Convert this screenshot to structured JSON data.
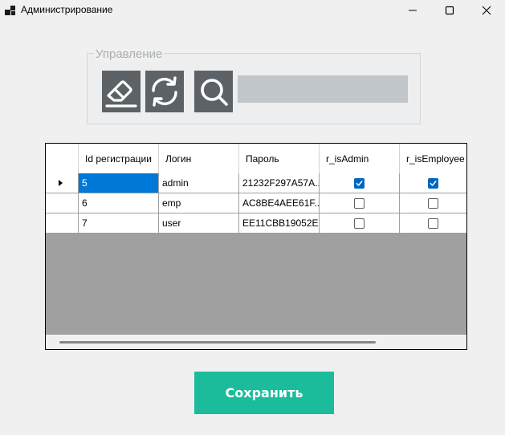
{
  "window": {
    "title": "Администрирование",
    "icon": "app-icon",
    "controls": [
      "minimize-icon",
      "maximize-icon",
      "close-icon"
    ]
  },
  "toolbar": {
    "group_label": "Управление",
    "buttons": [
      {
        "icon": "eraser-icon"
      },
      {
        "icon": "refresh-icon"
      },
      {
        "icon": "search-icon"
      }
    ],
    "search_value": "",
    "search_placeholder": ""
  },
  "grid": {
    "columns": [
      "Id регистрации",
      "Логин",
      "Пароль",
      "r_isAdmin",
      "r_isEmployee"
    ],
    "rows": [
      {
        "id": "5",
        "login": "admin",
        "password": "21232F297A57A...",
        "is_admin": true,
        "is_employee": true
      },
      {
        "id": "6",
        "login": "emp",
        "password": "AC8BE4AEE61F...",
        "is_admin": false,
        "is_employee": false
      },
      {
        "id": "7",
        "login": "user",
        "password": "EE11CBB19052E...",
        "is_admin": false,
        "is_employee": false
      }
    ],
    "current_row": 0
  },
  "save_label": "Сохранить",
  "colors": {
    "save_button": "#1abc9c",
    "tool_button": "#5d6266",
    "selection": "#0078d7",
    "checkbox_checked": "#0067c0"
  }
}
